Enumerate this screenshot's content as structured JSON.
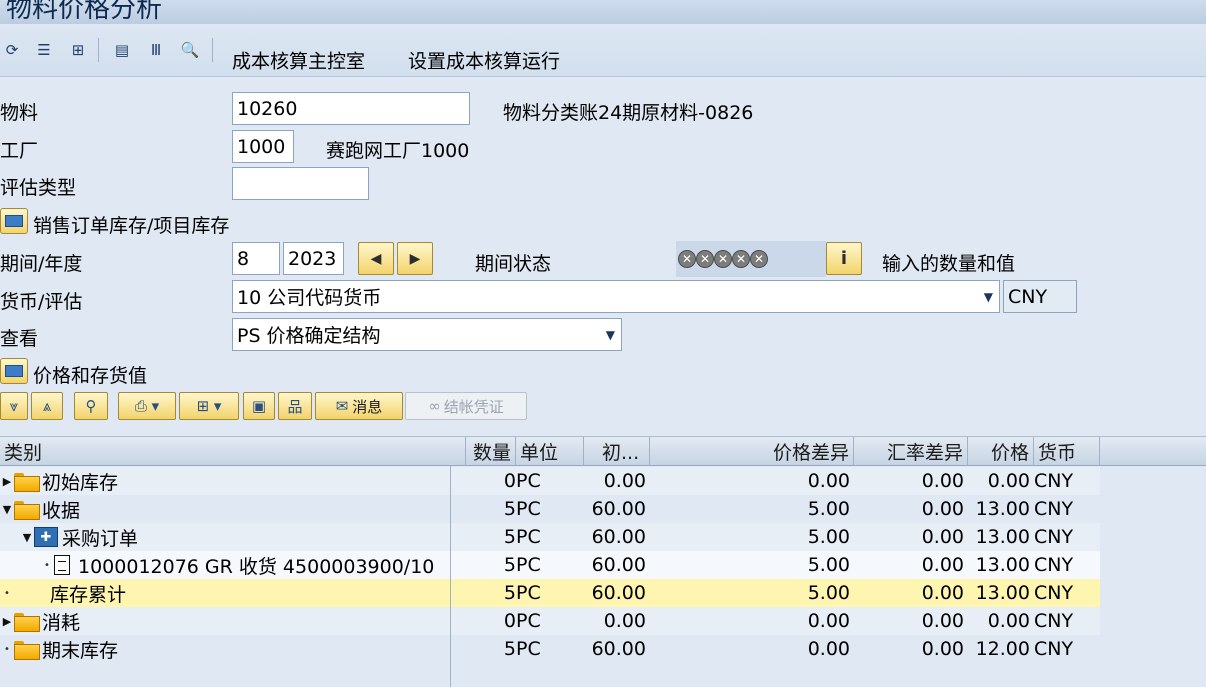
{
  "window": {
    "title": "物料价格分析"
  },
  "toolbar": {
    "icons": [
      "refresh-icon",
      "list-icon",
      "hierarchy-icon",
      "layout-icon",
      "columns-icon",
      "search-settings-icon"
    ],
    "cost_estimate_cockpit_label": "成本核算主控室",
    "costing_run_setup_label": "设置成本核算运行"
  },
  "form": {
    "material": {
      "label": "物料",
      "value": "10260",
      "description": "物料分类账24期原材料-0826"
    },
    "plant": {
      "label": "工厂",
      "value": "1000",
      "description": "赛跑网工厂1000"
    },
    "valuation_type": {
      "label": "评估类型",
      "value": ""
    },
    "sales_order_stock_label": "销售订单库存/项目库存",
    "period_year": {
      "label": "期间/年度",
      "period": "8",
      "year": "2023"
    },
    "period_status": {
      "label": "期间状态",
      "lights": [
        "✕",
        "✕",
        "✕",
        "✕",
        "✕"
      ],
      "info_label": "输入的数量和值"
    },
    "currency_valuation": {
      "label": "货币/评估",
      "value": "10 公司代码货币",
      "currency": "CNY"
    },
    "view": {
      "label": "查看",
      "value": "PS 价格确定结构"
    },
    "prices_inventory_label": "价格和存货值"
  },
  "grid_toolbar": {
    "messages_label": "消息",
    "closing_document_label": "结帐凭证"
  },
  "grid": {
    "columns": [
      "类别",
      "数量",
      "单位",
      "初...",
      "价格差异",
      "汇率差异",
      "价格",
      "货币"
    ],
    "rows": [
      {
        "category": "初始库存",
        "qty": "0",
        "unit": "PC",
        "initial": "0.00",
        "price_diff": "0.00",
        "fx_diff": "0.00",
        "price": "0.00",
        "currency": "CNY"
      },
      {
        "category": "收据",
        "qty": "5",
        "unit": "PC",
        "initial": "60.00",
        "price_diff": "5.00",
        "fx_diff": "0.00",
        "price": "13.00",
        "currency": "CNY"
      },
      {
        "category": "采购订单",
        "qty": "5",
        "unit": "PC",
        "initial": "60.00",
        "price_diff": "5.00",
        "fx_diff": "0.00",
        "price": "13.00",
        "currency": "CNY"
      },
      {
        "category": "1000012076 GR 收货 4500003900/10",
        "qty": "5",
        "unit": "PC",
        "initial": "60.00",
        "price_diff": "5.00",
        "fx_diff": "0.00",
        "price": "13.00",
        "currency": "CNY"
      },
      {
        "category": "库存累计",
        "qty": "5",
        "unit": "PC",
        "initial": "60.00",
        "price_diff": "5.00",
        "fx_diff": "0.00",
        "price": "13.00",
        "currency": "CNY"
      },
      {
        "category": "消耗",
        "qty": "0",
        "unit": "PC",
        "initial": "0.00",
        "price_diff": "0.00",
        "fx_diff": "0.00",
        "price": "0.00",
        "currency": "CNY"
      },
      {
        "category": "期末库存",
        "qty": "5",
        "unit": "PC",
        "initial": "60.00",
        "price_diff": "0.00",
        "fx_diff": "0.00",
        "price": "12.00",
        "currency": "CNY"
      }
    ]
  },
  "colors": {
    "background": "#dfe8f3",
    "row_alt": "#e8eef6",
    "row_highlight": "#fdf5b0",
    "accent_yellow": "#f2d46c"
  }
}
